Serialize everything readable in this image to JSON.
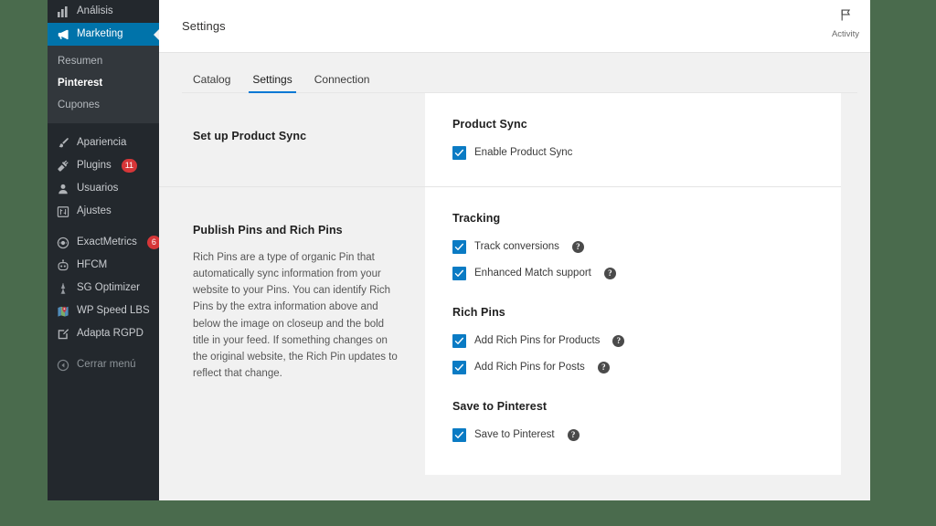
{
  "theme": {
    "desktop_bg": "#4a6b4d",
    "sidebar_bg": "#23282d",
    "submenu_bg": "#32373c",
    "accent_blue": "#0078d4",
    "wp_blue": "#0073aa",
    "checkbox_blue": "#0a7bc4",
    "badge_red": "#d63638"
  },
  "sidebar": {
    "items": [
      {
        "label": "Análisis",
        "icon": "chart-bar-icon",
        "state": "normal"
      },
      {
        "label": "Marketing",
        "icon": "megaphone-icon",
        "state": "current"
      }
    ],
    "submenu": [
      {
        "label": "Resumen",
        "active": false
      },
      {
        "label": "Pinterest",
        "active": true
      },
      {
        "label": "Cupones",
        "active": false
      }
    ],
    "group_two": [
      {
        "label": "Apariencia",
        "icon": "paintbrush-icon",
        "badge": null
      },
      {
        "label": "Plugins",
        "icon": "plug-icon",
        "badge": "11"
      },
      {
        "label": "Usuarios",
        "icon": "user-icon",
        "badge": null
      },
      {
        "label": "Ajustes",
        "icon": "sliders-icon",
        "badge": null
      }
    ],
    "group_three": [
      {
        "label": "ExactMetrics",
        "icon": "exactmetrics-icon",
        "badge": "6"
      },
      {
        "label": "HFCM",
        "icon": "robot-icon",
        "badge": null
      },
      {
        "label": "SG Optimizer",
        "icon": "sg-optimizer-icon",
        "badge": null
      },
      {
        "label": "WP Speed LBS",
        "icon": "map-pin-icon",
        "badge": null
      },
      {
        "label": "Adapta RGPD",
        "icon": "pencil-square-icon",
        "badge": null
      }
    ],
    "collapse": {
      "label": "Cerrar menú",
      "icon": "collapse-arrow-icon"
    }
  },
  "header": {
    "title": "Settings",
    "activity": {
      "label": "Activity",
      "icon": "flag-icon"
    }
  },
  "tabs": [
    {
      "label": "Catalog",
      "active": false
    },
    {
      "label": "Settings",
      "active": true
    },
    {
      "label": "Connection",
      "active": false
    }
  ],
  "sections": [
    {
      "left_title": "Set up Product Sync",
      "left_body": "",
      "groups": [
        {
          "title": "Product Sync",
          "options": [
            {
              "label": "Enable Product Sync",
              "checked": true,
              "help": false
            }
          ]
        }
      ]
    },
    {
      "left_title": "Publish Pins and Rich Pins",
      "left_body": "Rich Pins are a type of organic Pin that automatically sync information from your website to your Pins. You can identify Rich Pins by the extra information above and below the image on closeup and the bold title in your feed. If something changes on the original website, the Rich Pin updates to reflect that change.",
      "groups": [
        {
          "title": "Tracking",
          "options": [
            {
              "label": "Track conversions",
              "checked": true,
              "help": true
            },
            {
              "label": "Enhanced Match support",
              "checked": true,
              "help": true
            }
          ]
        },
        {
          "title": "Rich Pins",
          "options": [
            {
              "label": "Add Rich Pins for Products",
              "checked": true,
              "help": true
            },
            {
              "label": "Add Rich Pins for Posts",
              "checked": true,
              "help": true
            }
          ]
        },
        {
          "title": "Save to Pinterest",
          "options": [
            {
              "label": "Save to Pinterest",
              "checked": true,
              "help": true
            }
          ]
        }
      ]
    }
  ],
  "icons": {
    "help_glyph": "?",
    "check_glyph": "✓"
  }
}
